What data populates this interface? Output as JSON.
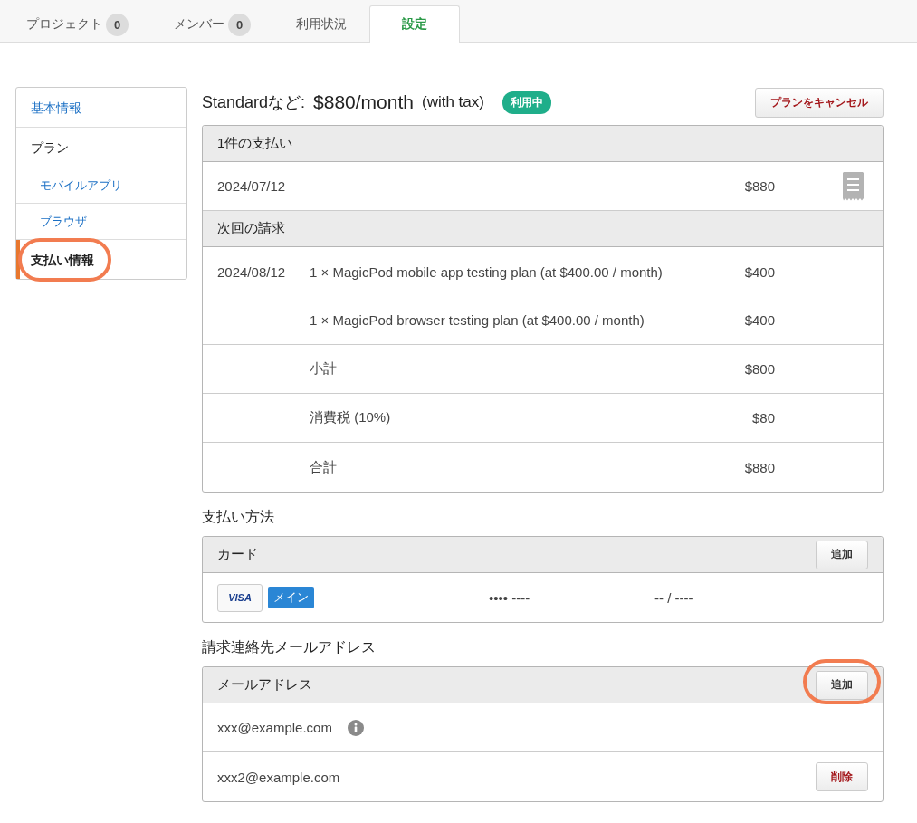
{
  "tabs": [
    {
      "label": "プロジェクト",
      "count": "0",
      "selected": false
    },
    {
      "label": "メンバー",
      "count": "0",
      "selected": false
    },
    {
      "label": "利用状況",
      "selected": false
    },
    {
      "label": "設定",
      "selected": true
    }
  ],
  "sidebar": {
    "items": [
      {
        "label": "基本情報",
        "kind": "link",
        "selected": false,
        "highlighted": false
      },
      {
        "label": "プラン",
        "kind": "group",
        "selected": false,
        "highlighted": false
      },
      {
        "label": "モバイルアプリ",
        "kind": "sublink",
        "selected": false,
        "highlighted": false
      },
      {
        "label": "ブラウザ",
        "kind": "sublink",
        "selected": false,
        "highlighted": false
      },
      {
        "label": "支払い情報",
        "kind": "link",
        "selected": true,
        "highlighted": true
      }
    ]
  },
  "plan": {
    "name": "Standardなど:",
    "price": "$880/month",
    "tax_note": "(with tax)",
    "status": "利用中",
    "cancel_button": "プランをキャンセル"
  },
  "payments": {
    "title": "1件の支払い",
    "rows": [
      {
        "date": "2024/07/12",
        "amount": "$880",
        "receipt": true
      }
    ]
  },
  "next_invoice": {
    "title": "次回の請求",
    "rows": [
      {
        "date": "2024/08/12",
        "lines": [
          {
            "description": "1 × MagicPod mobile app testing plan (at $400.00 / month)",
            "amount": "$400"
          },
          {
            "description": "1 × MagicPod browser testing plan (at $400.00 / month)",
            "amount": "$400"
          }
        ]
      },
      {
        "lines": [
          {
            "description": "小計",
            "amount": "$800"
          }
        ]
      },
      {
        "lines": [
          {
            "description": "消費税 (10%)",
            "amount": "$80"
          }
        ]
      },
      {
        "lines": [
          {
            "description": "合計",
            "amount": "$880"
          }
        ]
      }
    ]
  },
  "payment_method": {
    "title": "支払い方法",
    "header": "カード",
    "add_button": {
      "label": "追加",
      "highlighted": false
    },
    "cards": [
      {
        "brand": "VISA",
        "badge": "メイン",
        "number": "•••• ----",
        "expiry": "-- / ----"
      }
    ]
  },
  "billing_emails": {
    "title": "請求連絡先メールアドレス",
    "header": "メールアドレス",
    "add_button": {
      "label": "追加",
      "highlighted": true
    },
    "rows": [
      {
        "email": "xxx@example.com",
        "info": true
      },
      {
        "email": "xxx2@example.com",
        "info": false,
        "delete_button": "削除"
      }
    ]
  }
}
